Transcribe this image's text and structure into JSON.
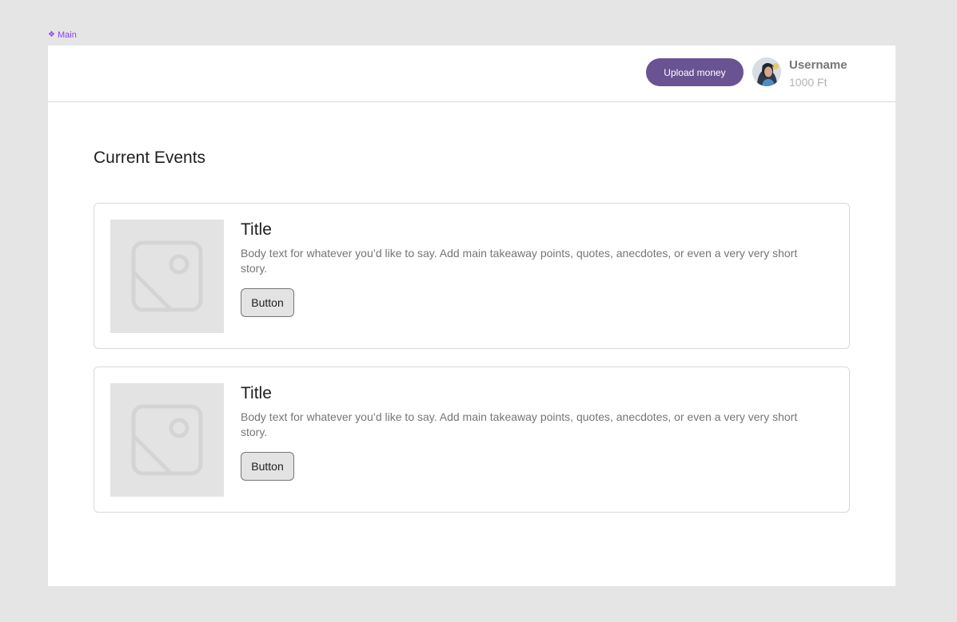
{
  "frame": {
    "label": "Main",
    "label_icon": "component-diamond-icon"
  },
  "header": {
    "upload_button_label": "Upload money",
    "user": {
      "name": "Username",
      "balance": "1000 Ft",
      "avatar_icon": "user-avatar"
    }
  },
  "main": {
    "section_title": "Current Events",
    "events": [
      {
        "title": "Title",
        "body": "Body text for whatever you’d like to say. Add main takeaway points, quotes, anecdotes, or even a very very short story.",
        "button_label": "Button",
        "image_icon": "image-placeholder-icon"
      },
      {
        "title": "Title",
        "body": "Body text for whatever you’d like to say. Add main takeaway points, quotes, anecdotes, or even a very very short story.",
        "button_label": "Button",
        "image_icon": "image-placeholder-icon"
      }
    ]
  },
  "colors": {
    "primary_button": "#6a5393",
    "frame_label": "#8a3ffc",
    "canvas": "#e5e5e5",
    "placeholder": "#e3e3e3"
  }
}
